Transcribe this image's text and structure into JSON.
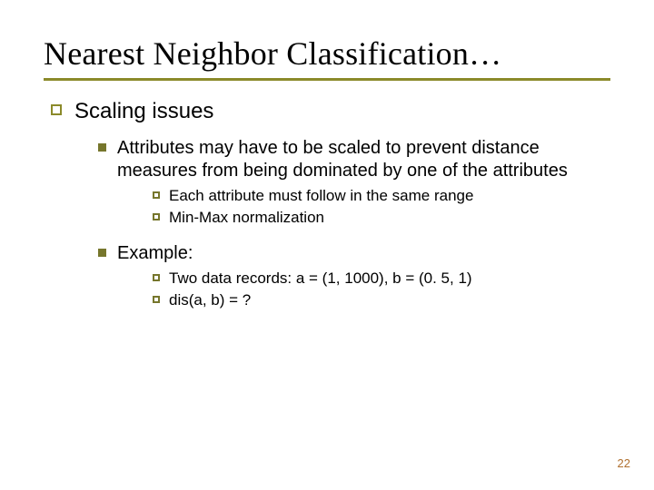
{
  "title": "Nearest Neighbor Classification…",
  "level1": {
    "text": "Scaling issues"
  },
  "level2a": {
    "text": "Attributes may have to be scaled to prevent distance measures from being dominated by one of the attributes"
  },
  "level3a1": {
    "text": "Each attribute must follow in the same range"
  },
  "level3a2": {
    "text": "Min-Max normalization"
  },
  "level2b": {
    "text": "Example:"
  },
  "level3b1": {
    "text": "Two data records: a = (1, 1000), b = (0. 5, 1)"
  },
  "level3b2": {
    "text": "dis(a, b) = ?"
  },
  "page_number": "22"
}
